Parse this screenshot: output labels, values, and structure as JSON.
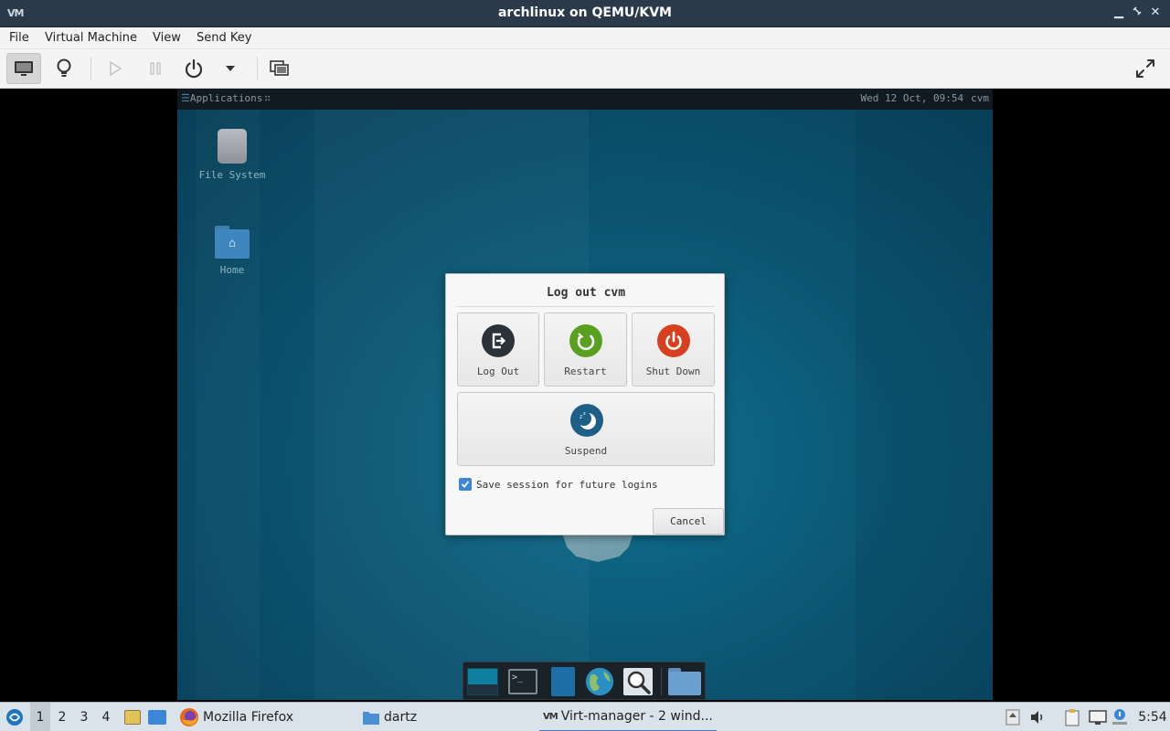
{
  "window": {
    "title": "archlinux on QEMU/KVM"
  },
  "menu": [
    "File",
    "Virtual Machine",
    "View",
    "Send Key"
  ],
  "guest": {
    "panel": {
      "applications": "Applications",
      "clock": "Wed 12 Oct, 09:54",
      "user": "cvm"
    },
    "desktop_icons": [
      {
        "label": "File System"
      },
      {
        "label": "Home"
      }
    ],
    "dialog": {
      "title": "Log out cvm",
      "actions": [
        {
          "label": "Log Out",
          "color": "#2c3338"
        },
        {
          "label": "Restart",
          "color": "#5aa020"
        },
        {
          "label": "Shut Down",
          "color": "#d6401f"
        },
        {
          "label": "Suspend",
          "color": "#1d5f86"
        }
      ],
      "save_session_label": "Save session for future logins",
      "save_session_checked": true,
      "cancel_label": "Cancel"
    }
  },
  "taskbar": {
    "workspaces": [
      "1",
      "2",
      "3",
      "4"
    ],
    "active_workspace": "1",
    "tasks": [
      {
        "label": "Mozilla Firefox"
      },
      {
        "label": "dartz"
      },
      {
        "label": "Virt-manager - 2 wind..."
      }
    ],
    "clock": "5:54"
  }
}
